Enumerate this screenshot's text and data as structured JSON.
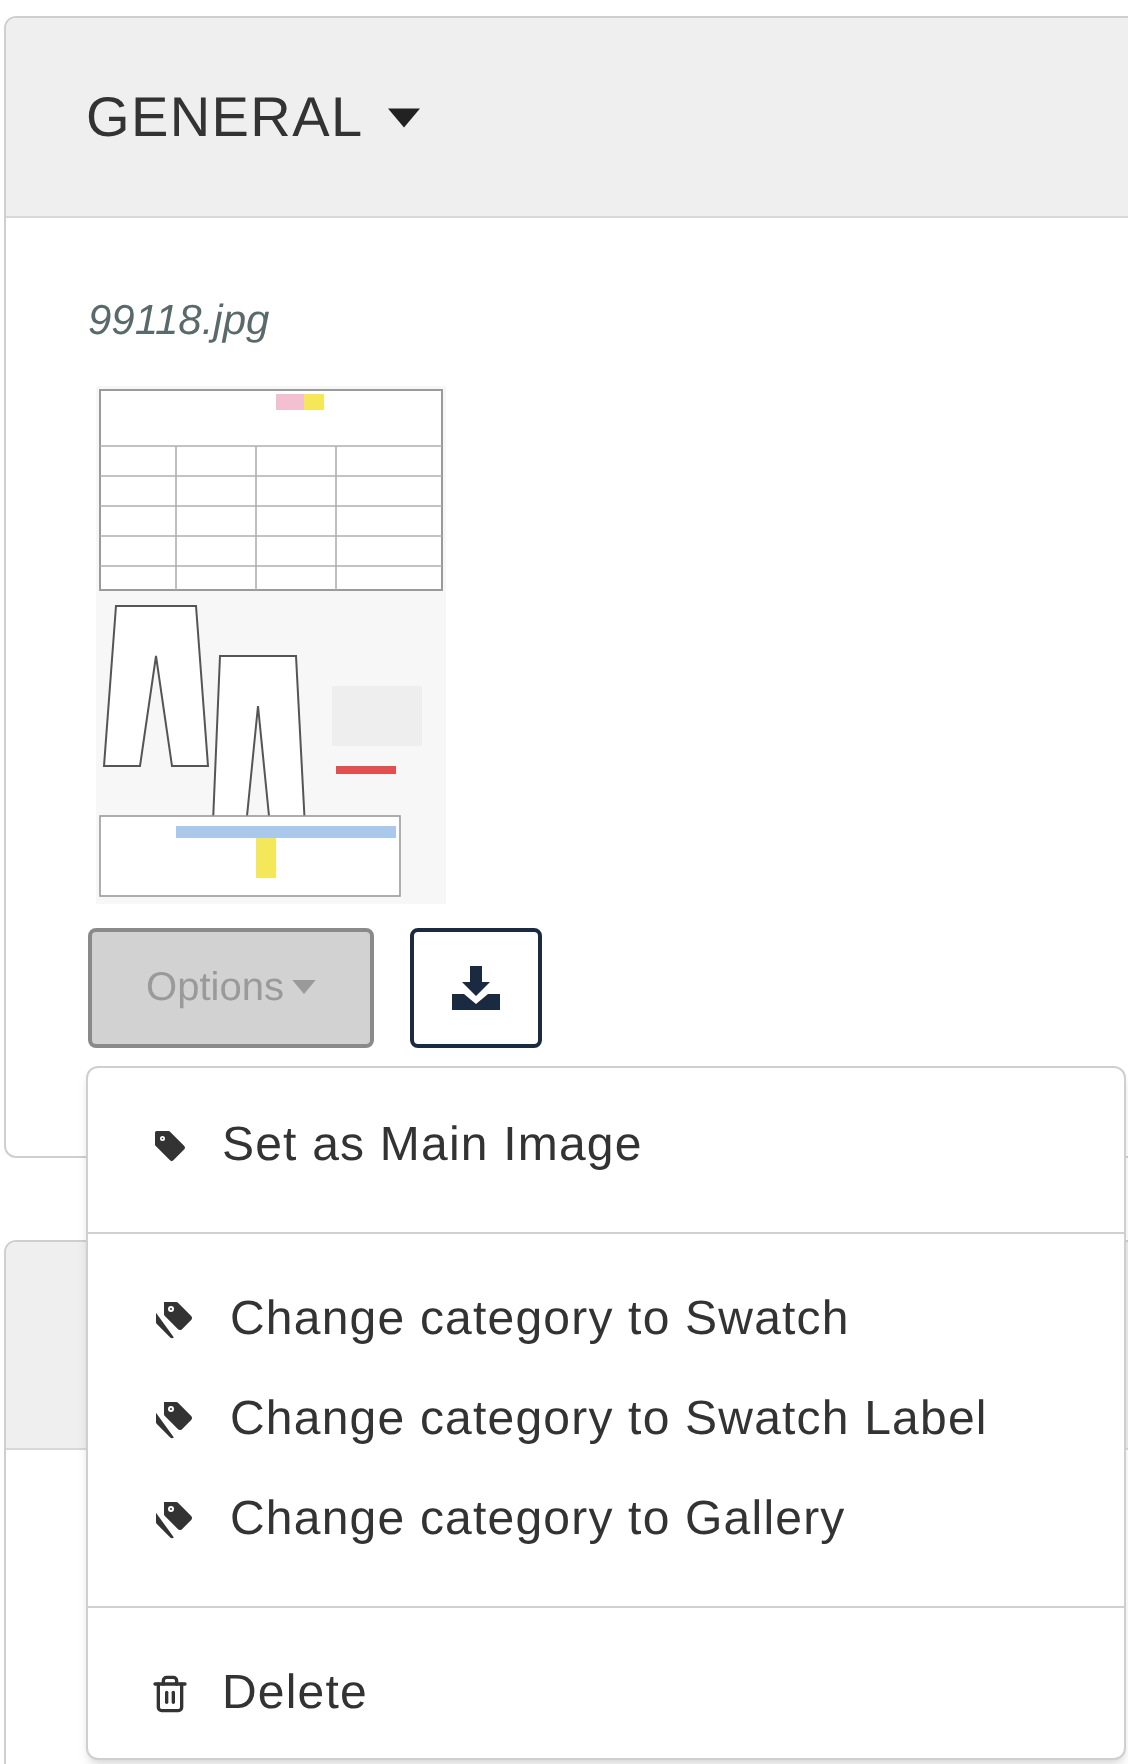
{
  "section": {
    "title": "GENERAL"
  },
  "image": {
    "filename": "99118.jpg",
    "kind": "picture"
  },
  "options_button": {
    "label": "Options",
    "disabled": true
  },
  "menu": {
    "groups": [
      [
        {
          "label": "Set as Main Image",
          "kind": "tag"
        }
      ],
      [
        {
          "label": "Change category to Swatch",
          "kind": "tags"
        },
        {
          "label": "Change category to Swatch Label",
          "kind": "tags"
        },
        {
          "label": "Change category to Gallery",
          "kind": "tags"
        }
      ],
      [
        {
          "label": "Delete",
          "kind": "trash"
        }
      ]
    ]
  }
}
